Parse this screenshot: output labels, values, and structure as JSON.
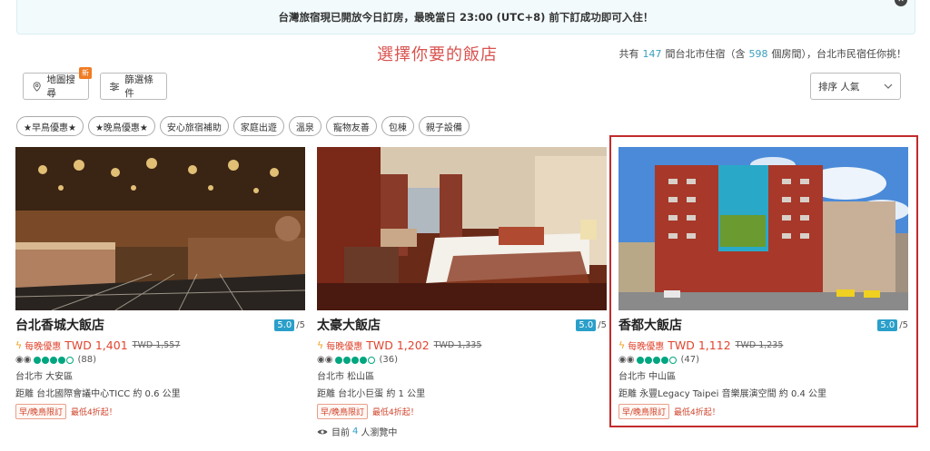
{
  "banner": {
    "text": "台灣旅宿現已開放今日訂房，最晚當日 23:00 (UTC+8) 前下訂成功即可入住！",
    "close_label": "✕"
  },
  "annotation_title": "選擇你要的飯店",
  "summary": {
    "prefix": "共有",
    "count": "147",
    "mid": "間台北市住宿（含",
    "rooms": "598",
    "suffix": "個房間），台北市民宿任你挑！"
  },
  "toolbar": {
    "map_search": "地圖搜尋",
    "new_tag": "新",
    "filter": "篩選條件",
    "sort_label": "排序 人氣"
  },
  "tags": [
    "★早鳥優惠★",
    "★晚鳥優惠★",
    "安心旅宿補助",
    "家庭出遊",
    "溫泉",
    "寵物友善",
    "包棟",
    "親子設備"
  ],
  "hotels": [
    {
      "name": "台北香城大飯店",
      "score": "5.0",
      "score_max": "/5",
      "deal_label": "每晚優惠",
      "price": "TWD 1,401",
      "old_price": "TWD 1,557",
      "reviews": "(88)",
      "rating_dots": 4,
      "district": "台北市 大安區",
      "distance": "距離 台北國際會議中心TICC 約 0.6 公里",
      "promo_chip": "早/晚鳥限訂",
      "promo_text": "最低4折起！"
    },
    {
      "name": "太豪大飯店",
      "score": "5.0",
      "score_max": "/5",
      "deal_label": "每晚優惠",
      "price": "TWD 1,202",
      "old_price": "TWD 1,335",
      "reviews": "(36)",
      "rating_dots": 4,
      "district": "台北市 松山區",
      "distance": "距離 台北小巨蛋 約 1 公里",
      "promo_chip": "早/晚鳥限訂",
      "promo_text": "最低4折起！",
      "viewers_prefix": "目前",
      "viewers_count": "4",
      "viewers_suffix": "人瀏覽中"
    },
    {
      "name": "香都大飯店",
      "score": "5.0",
      "score_max": "/5",
      "deal_label": "每晚優惠",
      "price": "TWD 1,112",
      "old_price": "TWD 1,235",
      "reviews": "(47)",
      "rating_dots": 4,
      "district": "台北市 中山區",
      "distance": "距離 永豐Legacy Taipei 音樂展演空間 約 0.4 公里",
      "promo_chip": "早/晚鳥限訂",
      "promo_text": "最低4折起！"
    }
  ],
  "colors": {
    "accent": "#2a9fc9",
    "price": "#e0462f",
    "highlight": "#c22b2b",
    "annotation": "#d9534f"
  }
}
